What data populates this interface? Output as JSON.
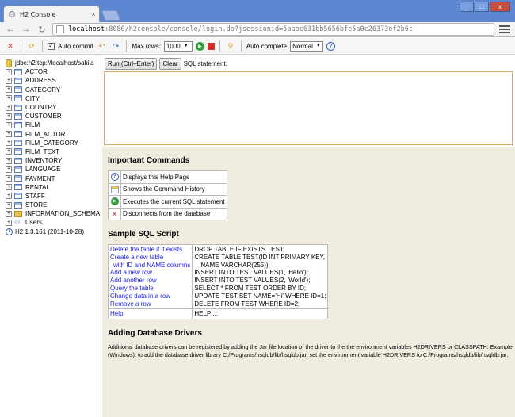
{
  "browser": {
    "tab_title": "H2 Console",
    "tab_close": "×",
    "address_host": "localhost",
    "address_rest": ":8080/h2console/console/login.do?jsessionid=5babc631bb5656bfe5a0c26373ef2b6c",
    "window_buttons": [
      "_",
      "□",
      "x"
    ]
  },
  "toolbar": {
    "auto_commit_label": "Auto commit",
    "auto_commit_checked": "✓",
    "max_rows_label": "Max rows:",
    "max_rows_value": "1000",
    "auto_complete_label": "Auto complete",
    "auto_complete_value": "Normal",
    "help_icon_text": "?"
  },
  "tree": {
    "connection": "jdbc:h2:tcp://localhost/sakila",
    "tables": [
      "ACTOR",
      "ADDRESS",
      "CATEGORY",
      "CITY",
      "COUNTRY",
      "CUSTOMER",
      "FILM",
      "FILM_ACTOR",
      "FILM_CATEGORY",
      "FILM_TEXT",
      "INVENTORY",
      "LANGUAGE",
      "PAYMENT",
      "RENTAL",
      "STAFF",
      "STORE"
    ],
    "schema": "INFORMATION_SCHEMA",
    "users": "Users",
    "version": "H2 1.3.161 (2011-10-28)",
    "expand_symbol": "+"
  },
  "sql": {
    "run_button": "Run (Ctrl+Enter)",
    "clear_button": "Clear",
    "statement_label": "SQL statement:"
  },
  "help": {
    "important_title": "Important Commands",
    "commands": [
      {
        "icon": "help-icon",
        "text": "Displays this Help Page"
      },
      {
        "icon": "history-icon",
        "text": "Shows the Command History"
      },
      {
        "icon": "run-icon",
        "text": "Executes the current SQL statement"
      },
      {
        "icon": "disconnect-icon",
        "text": "Disconnects from the database"
      }
    ],
    "sample_title": "Sample SQL Script",
    "sample_links": [
      "Delete the table if it exists",
      "Create a new table",
      "with ID and NAME columns",
      "Add a new row",
      "Add another row",
      "Query the table",
      "Change data in a row",
      "Remove a row"
    ],
    "sample_code": [
      "DROP TABLE IF EXISTS TEST;",
      "CREATE TABLE TEST(ID INT PRIMARY KEY,",
      "NAME VARCHAR(255));",
      "INSERT INTO TEST VALUES(1, 'Hello');",
      "INSERT INTO TEST VALUES(2, 'World');",
      "SELECT * FROM TEST ORDER BY ID;",
      "UPDATE TEST SET NAME='Hi' WHERE ID=1;",
      "DELETE FROM TEST WHERE ID=2;"
    ],
    "help_link": "Help",
    "help_code": "HELP ...",
    "drivers_title": "Adding Database Drivers",
    "drivers_text": "Additional database drivers can be registered by adding the Jar file location of the driver to the the environment variables H2DRIVERS or CLASSPATH. Example (Windows): to add the database driver library C:/Programs/hsqldb/lib/hsqldb.jar, set the environment variable H2DRIVERS to C:/Programs/hsqldb/lib/hsqldb.jar."
  }
}
